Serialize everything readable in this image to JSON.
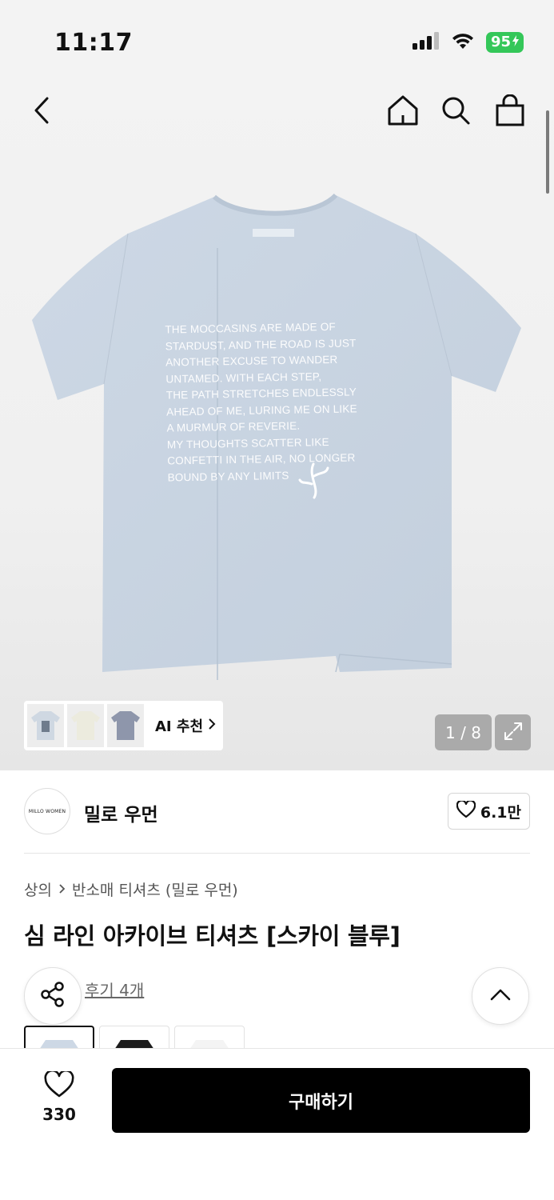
{
  "status_bar": {
    "time": "11:17",
    "battery": "95"
  },
  "hero": {
    "shirt_print": "THE MOCCASINS ARE MADE OF\nSTARDUST, AND THE ROAD IS JUST\nANOTHER EXCUSE TO WANDER\nUNTAMED. WITH EACH STEP,\nTHE PATH STRETCHES ENDLESSLY\nAHEAD OF ME, LURING ME ON LIKE\nA MURMUR OF REVERIE.\nMY THOUGHTS SCATTER LIKE\nCONFETTI IN THE AIR, NO LONGER\nBOUND BY ANY LIMITS",
    "ai_label": "AI 추천",
    "counter": "1 / 8",
    "shirt_color": "#c9d5e3"
  },
  "brand": {
    "logo_text": "MILLO WOMEN",
    "name": "밀로 우먼",
    "likes": "6.1만"
  },
  "breadcrumb": {
    "category": "상의",
    "subcategory": "반소매 티셔츠 (밀로 우먼)"
  },
  "product": {
    "title": "심 라인 아카이브 티셔츠 [스카이 블루]",
    "reviews": "후기 4개"
  },
  "bottom_bar": {
    "wish_count": "330",
    "buy_label": "구매하기"
  },
  "colors": {
    "accent": "#000000",
    "battery": "#34c759"
  }
}
